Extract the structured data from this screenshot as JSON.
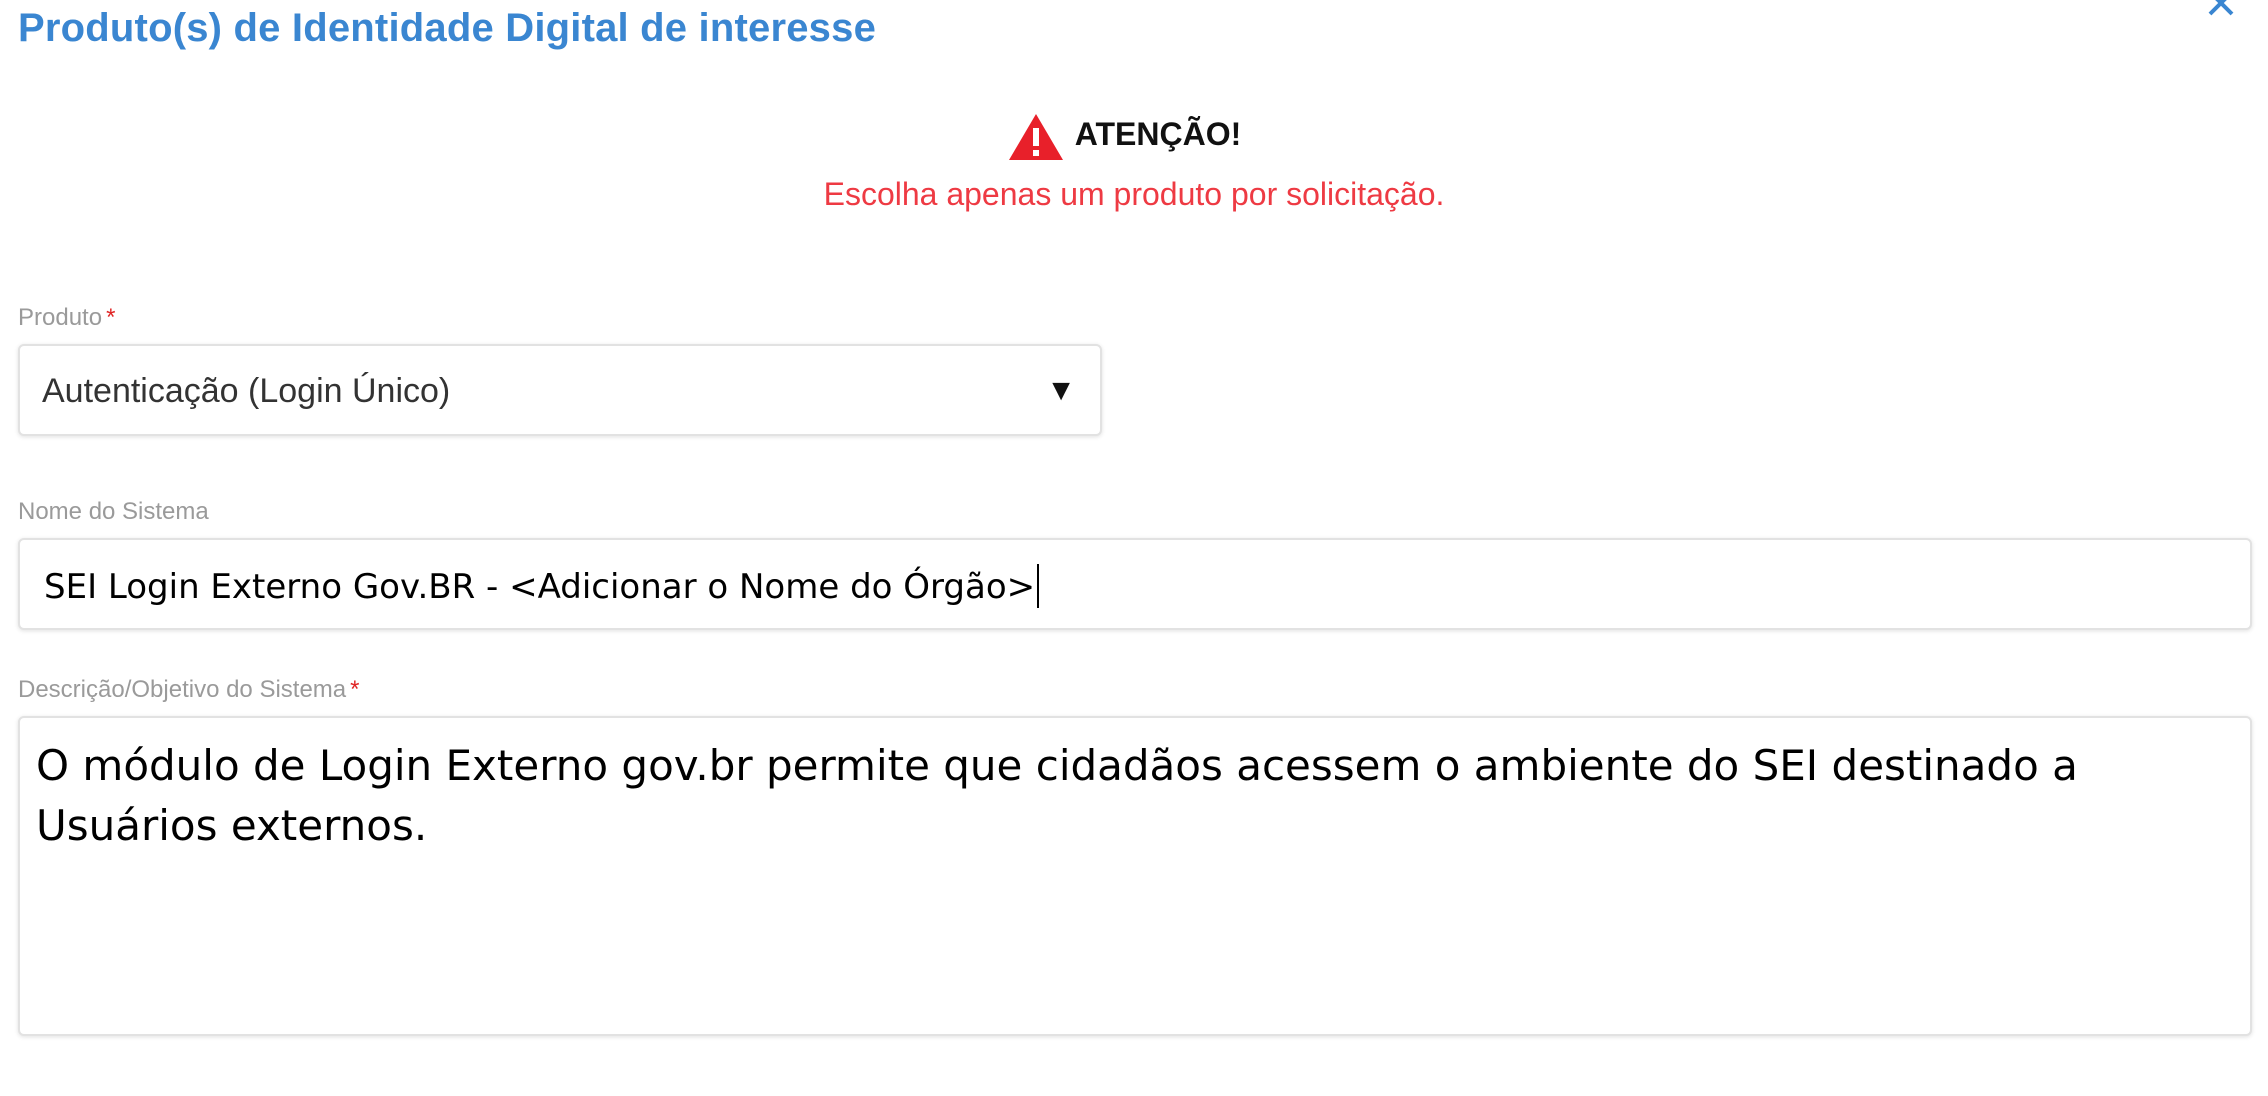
{
  "dialog": {
    "title": "Produto(s) de Identidade Digital de interesse",
    "close_icon": "close-icon"
  },
  "alert": {
    "icon": "warning-triangle-icon",
    "title": "ATENÇÃO!",
    "message": "Escolha apenas um produto por solicitação.",
    "color": "#ee3a43"
  },
  "form": {
    "produto": {
      "label": "Produto",
      "required_mark": "*",
      "value": "Autenticação (Login Único)",
      "icon": "dropdown-arrow-icon"
    },
    "nome_sistema": {
      "label": "Nome do Sistema",
      "value": "SEI Login Externo Gov.BR - <Adicionar o Nome do Órgão>"
    },
    "descricao": {
      "label": "Descrição/Objetivo do Sistema",
      "required_mark": "*",
      "value": "O módulo de Login Externo gov.br permite que cidadãos acessem o ambiente do SEI destinado a Usuários externos."
    }
  },
  "colors": {
    "title": "#3a86d1",
    "required": "#e02525",
    "label": "#9a9a9a"
  }
}
